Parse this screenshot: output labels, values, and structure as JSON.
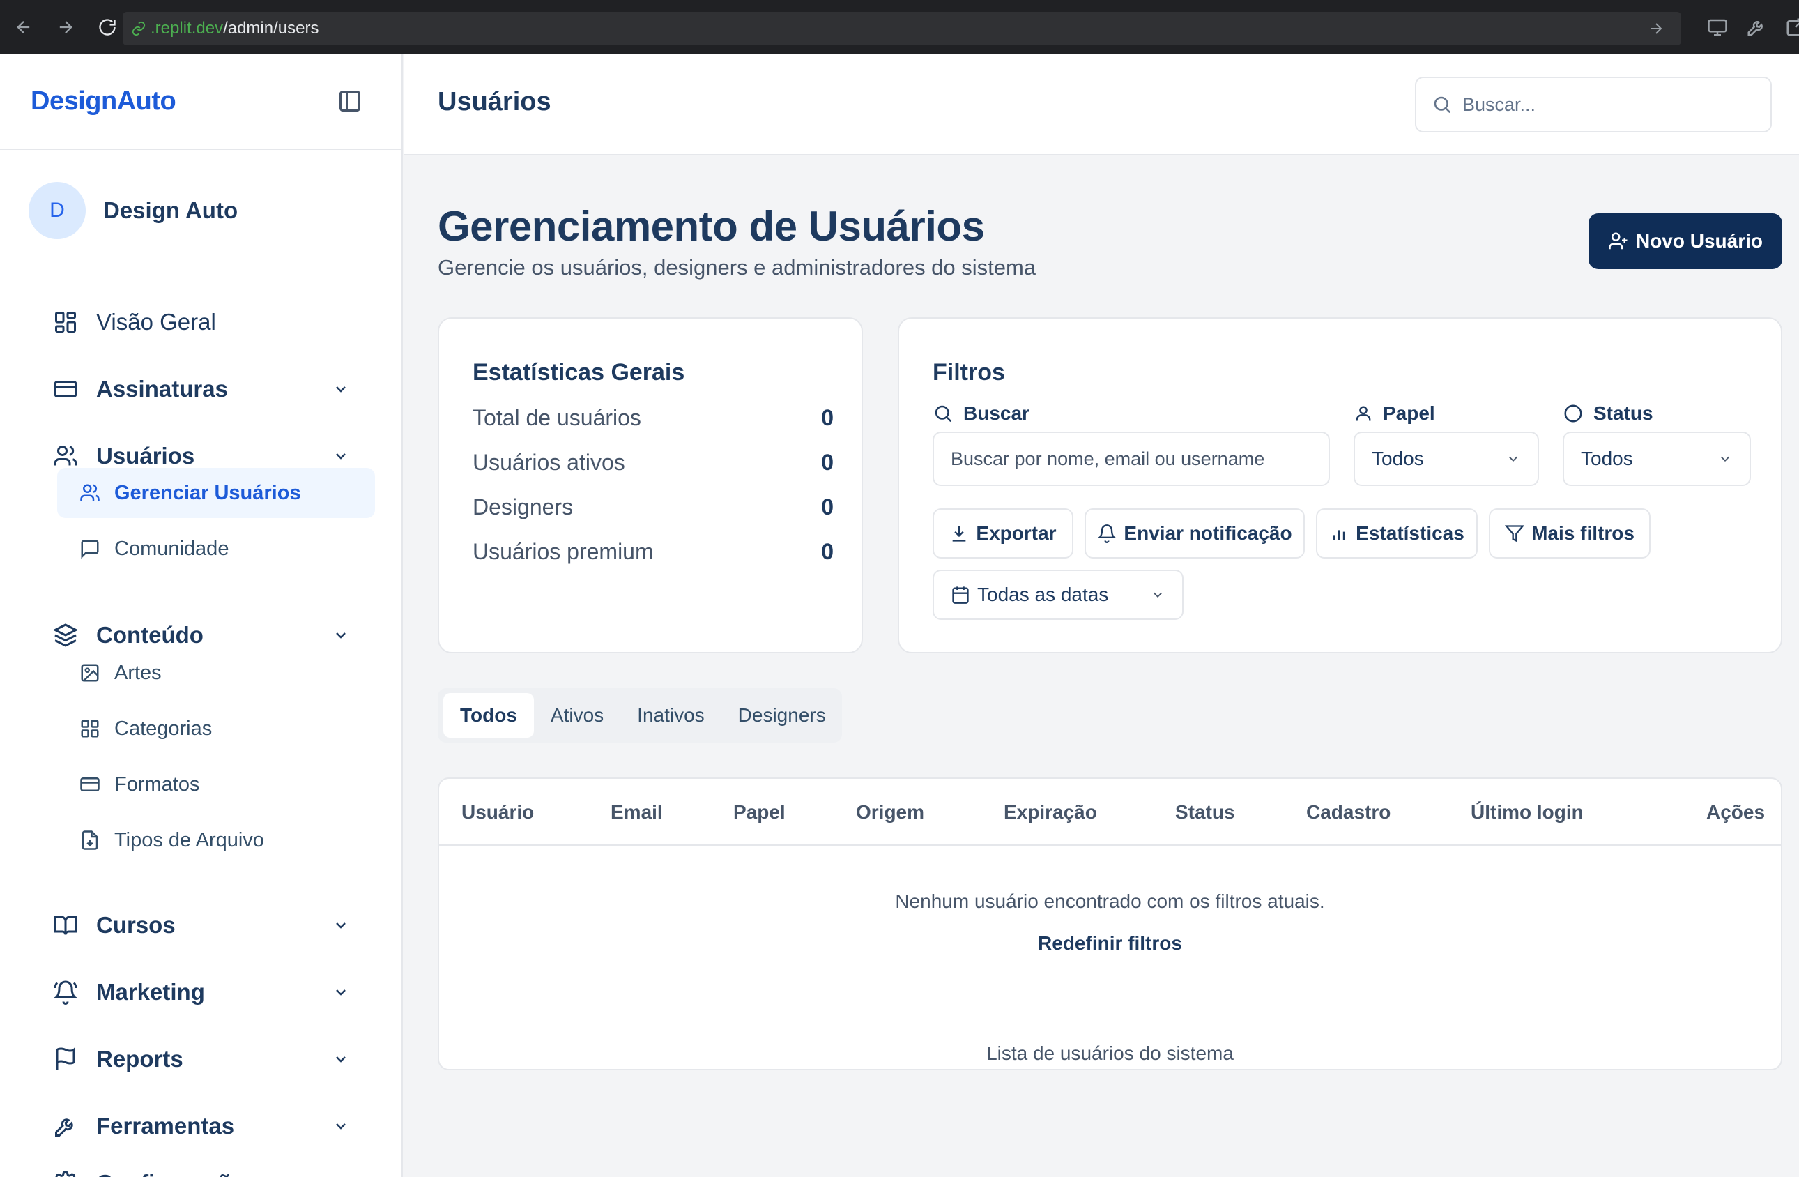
{
  "browser": {
    "url_host_prefix": ".replit.dev",
    "url_path": "/admin/users"
  },
  "sidebar": {
    "brand": "DesignAuto",
    "user": {
      "avatar_initial": "D",
      "name": "Design Auto"
    },
    "items": [
      {
        "label": "Visão Geral",
        "icon": "dashboard-icon"
      },
      {
        "label": "Assinaturas",
        "icon": "credit-card-icon"
      },
      {
        "label": "Usuários",
        "icon": "users-icon"
      },
      {
        "label": "Conteúdo",
        "icon": "layers-icon"
      },
      {
        "label": "Cursos",
        "icon": "book-icon"
      },
      {
        "label": "Marketing",
        "icon": "bell-ring-icon"
      },
      {
        "label": "Reports",
        "icon": "flag-icon"
      },
      {
        "label": "Ferramentas",
        "icon": "wrench-icon"
      },
      {
        "label": "Configurações",
        "icon": "settings-icon"
      }
    ],
    "users_sub": [
      {
        "label": "Gerenciar Usuários",
        "active": true
      },
      {
        "label": "Comunidade",
        "active": false
      }
    ],
    "content_sub": [
      {
        "label": "Artes"
      },
      {
        "label": "Categorias"
      },
      {
        "label": "Formatos"
      },
      {
        "label": "Tipos de Arquivo"
      }
    ]
  },
  "header": {
    "title": "Usuários",
    "search_placeholder": "Buscar..."
  },
  "main": {
    "title": "Gerenciamento de Usuários",
    "subtitle": "Gerencie os usuários, designers e administradores do sistema",
    "new_user_label": "Novo Usuário"
  },
  "stats": {
    "title": "Estatísticas Gerais",
    "rows": [
      {
        "label": "Total de usuários",
        "value": "0"
      },
      {
        "label": "Usuários ativos",
        "value": "0"
      },
      {
        "label": "Designers",
        "value": "0"
      },
      {
        "label": "Usuários premium",
        "value": "0"
      }
    ]
  },
  "filters": {
    "title": "Filtros",
    "search_label": "Buscar",
    "search_placeholder": "Buscar por nome, email ou username",
    "role_label": "Papel",
    "role_value": "Todos",
    "status_label": "Status",
    "status_value": "Todos",
    "export_label": "Exportar",
    "notify_label": "Enviar notificação",
    "stats_label": "Estatísticas",
    "more_filters_label": "Mais filtros",
    "date_value": "Todas as datas"
  },
  "tabs": [
    {
      "label": "Todos",
      "active": true
    },
    {
      "label": "Ativos",
      "active": false
    },
    {
      "label": "Inativos",
      "active": false
    },
    {
      "label": "Designers",
      "active": false
    }
  ],
  "table": {
    "columns": [
      "Usuário",
      "Email",
      "Papel",
      "Origem",
      "Expiração",
      "Status",
      "Cadastro",
      "Último login",
      "Ações"
    ],
    "empty_message": "Nenhum usuário encontrado com os filtros atuais.",
    "reset_label": "Redefinir filtros",
    "caption": "Lista de usuários do sistema"
  },
  "colors": {
    "brand": "#1d5bd8",
    "primary_button": "#0f2d57",
    "text_primary": "#1e3a5f",
    "active_bg": "#eff6ff"
  }
}
